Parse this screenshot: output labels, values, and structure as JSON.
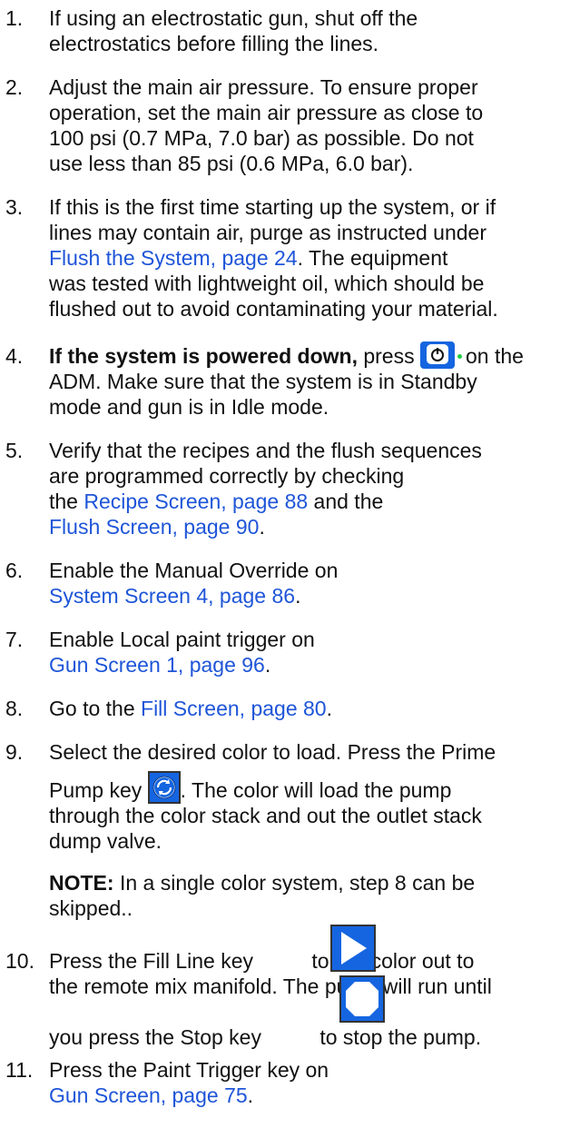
{
  "steps": [
    {
      "num": "1.",
      "lines": [
        "If using an electrostatic gun, shut off the",
        "electrostatics before filling the lines."
      ]
    },
    {
      "num": "2.",
      "lines": [
        "Adjust the main air pressure. To ensure proper",
        "operation, set the main air pressure as close to",
        "100 psi (0.7 MPa, 7.0 bar) as possible. Do not",
        "use less than 85 psi (0.6 MPa, 6.0 bar)."
      ]
    },
    {
      "num": "3.",
      "l1": "If this is the first time starting up the system, or if",
      "l2": "lines may contain air, purge as instructed under",
      "link": "Flush the System, page 24",
      "l3_after": ". The equipment",
      "l4": "was tested with lightweight oil, which should be",
      "l5": "flushed out to avoid contaminating your material."
    },
    {
      "num": "4.",
      "bold": "If the system is powered down,",
      "press": " press ",
      "after_icon": "on the",
      "l2": "ADM. Make sure that the system is in Standby",
      "l3": "mode and gun is in Idle mode."
    },
    {
      "num": "5.",
      "l1": "Verify that the recipes and the flush sequences",
      "l2": "are programmed correctly by checking",
      "l3_pre": "the ",
      "link1": "Recipe Screen, page 88",
      "l3_post": " and the",
      "link2": "Flush Screen, page 90",
      "l4_post": "."
    },
    {
      "num": "6.",
      "l1": "Enable the Manual Override on",
      "link": "System Screen 4, page 86",
      "post": "."
    },
    {
      "num": "7.",
      "l1": "Enable Local paint trigger on",
      "link": "Gun Screen 1, page 96",
      "post": "."
    },
    {
      "num": "8.",
      "pre": "Go to the ",
      "link": "Fill Screen, page 80",
      "post": "."
    },
    {
      "num": "9.",
      "l1": "Select the desired color to load. Press the Prime",
      "l2_pre": "Pump key ",
      "l2_post": ". The color will load the pump",
      "l3": "through the color stack and out the outlet stack",
      "l4": "dump valve.",
      "note_label": "NOTE:",
      "note_text": " In a single color system, step 8 can be",
      "note_l2": "skipped.."
    },
    {
      "num": "10.",
      "l1_pre": "Press the Fill Line key ",
      "l1_post": " to run color out to",
      "l2": "the remote mix manifold. The pump will run until",
      "l3_pre": "you press the Stop key ",
      "l3_post": " to stop the pump."
    },
    {
      "num": "11.",
      "l1": "Press the Paint Trigger key on",
      "link": "Gun Screen, page 75",
      "post": "."
    }
  ],
  "icons": {
    "power": "power-key-icon",
    "prime": "prime-pump-icon",
    "fill": "fill-line-icon",
    "stop": "stop-key-icon"
  },
  "colors": {
    "link": "#1e55d8",
    "key_blue": "#1565e0",
    "power_dot": "#22cc44"
  }
}
